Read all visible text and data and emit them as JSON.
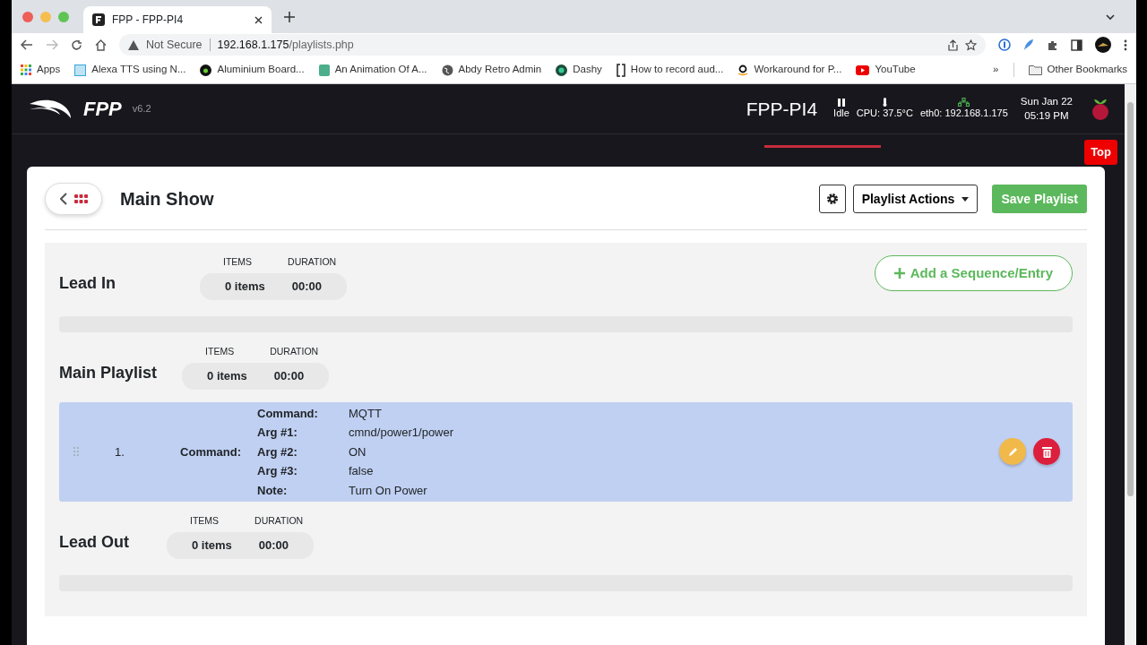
{
  "browser": {
    "tab_title": "FPP - FPP-PI4",
    "security": "Not Secure",
    "url_host": "192.168.1.175",
    "url_path": "/playlists.php",
    "bookmarks": [
      {
        "label": "Apps",
        "kind": "apps"
      },
      {
        "label": "Alexa TTS using N...",
        "kind": "square"
      },
      {
        "label": "Aluminium Board...",
        "kind": "b"
      },
      {
        "label": "An Animation Of A...",
        "kind": "doc"
      },
      {
        "label": "Abdy Retro Admin",
        "kind": "globe"
      },
      {
        "label": "Dashy",
        "kind": "dash"
      },
      {
        "label": "How to record aud...",
        "kind": "bracket"
      },
      {
        "label": "Workaround for P...",
        "kind": "amazon"
      },
      {
        "label": "YouTube",
        "kind": "youtube"
      }
    ],
    "overflow": "»",
    "other_bookmarks": "Other Bookmarks"
  },
  "app": {
    "logo": "FPP",
    "version": "v6.2",
    "hostname": "FPP-PI4",
    "status": "Idle",
    "cpu": "CPU: 37.5°C",
    "network": "eth0: 192.168.1.175",
    "date": "Sun Jan 22",
    "time": "05:19 PM",
    "top_button": "Top"
  },
  "playlist": {
    "title": "Main Show",
    "actions_button": "Playlist Actions",
    "save_button": "Save Playlist",
    "add_button": "Add a Sequence/Entry",
    "sections": [
      {
        "name": "Lead In",
        "items_label": "ITEMS",
        "duration_label": "DURATION",
        "items": "0 items",
        "duration": "00:00"
      },
      {
        "name": "Main Playlist",
        "items_label": "ITEMS",
        "duration_label": "DURATION",
        "items": "0 items",
        "duration": "00:00",
        "entries": [
          {
            "number": "1.",
            "type_label": "Command:",
            "selected": true,
            "fields": [
              {
                "label": "Command:",
                "value": "MQTT"
              },
              {
                "label": "Arg #1:",
                "value": "cmnd/power1/power"
              },
              {
                "label": "Arg #2:",
                "value": "ON"
              },
              {
                "label": "Arg #3:",
                "value": "false"
              },
              {
                "label": "Note:",
                "value": "Turn On Power"
              }
            ]
          }
        ]
      },
      {
        "name": "Lead Out",
        "items_label": "ITEMS",
        "duration_label": "DURATION",
        "items": "0 items",
        "duration": "00:00"
      }
    ]
  }
}
